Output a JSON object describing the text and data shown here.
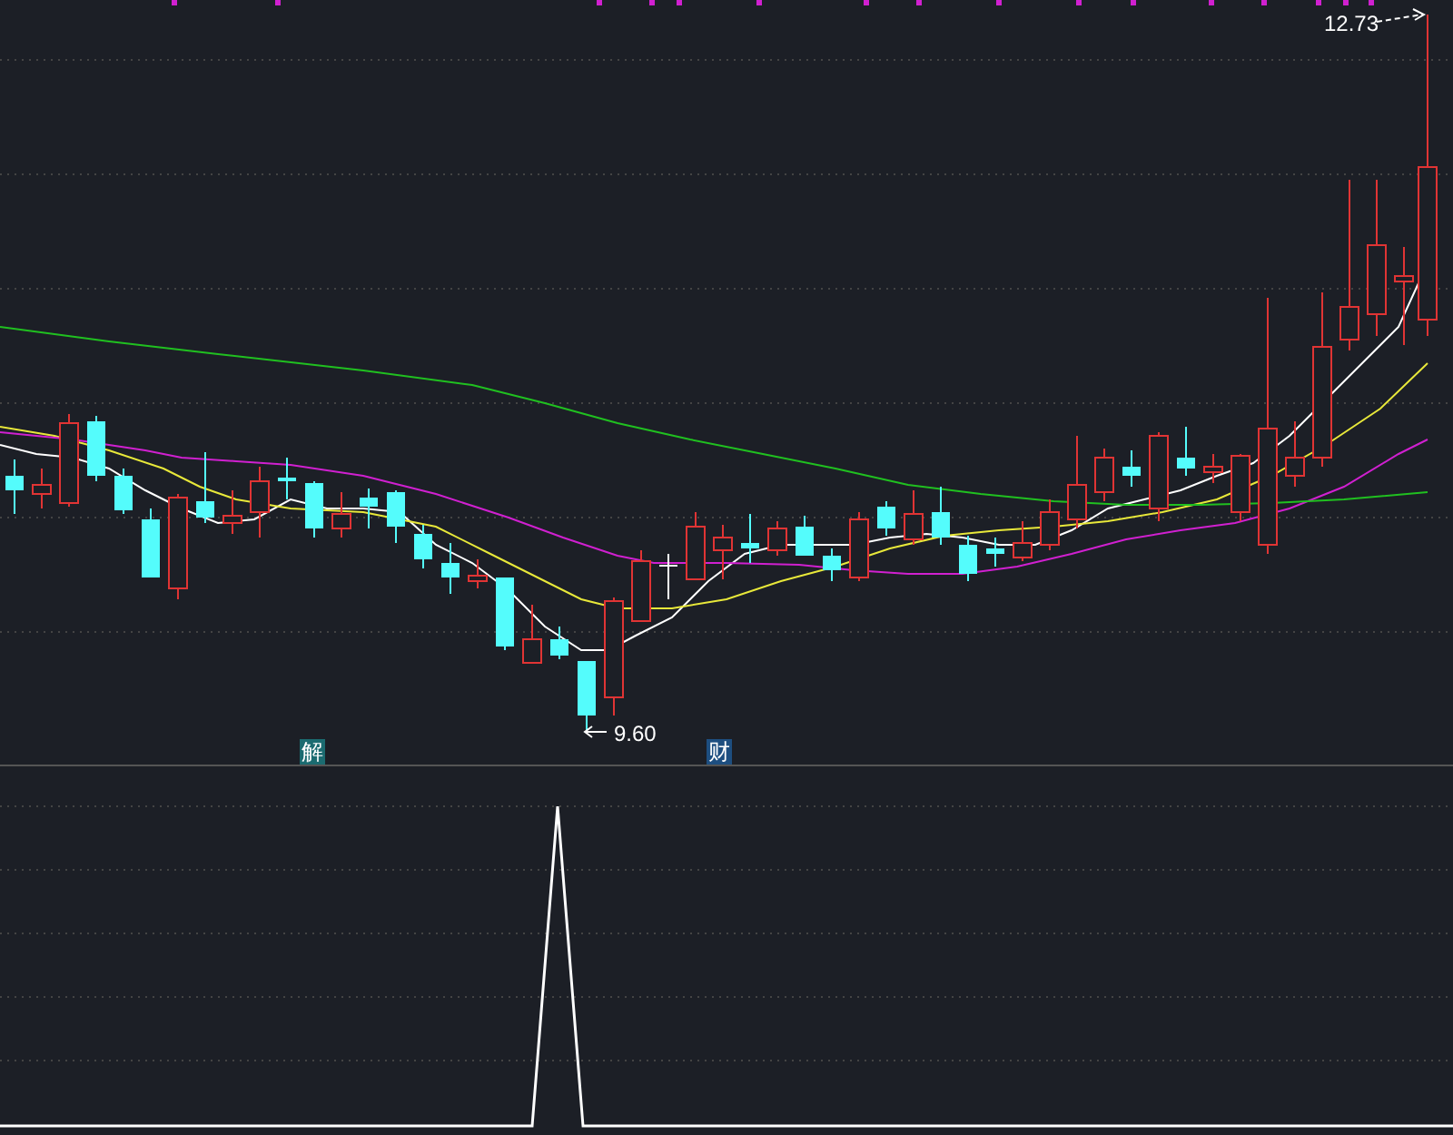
{
  "price_chart": {
    "high_label": "12.73",
    "low_label": "9.60",
    "signals": [
      {
        "label": "解",
        "color": "#1b6b70"
      },
      {
        "label": "财",
        "color": "#1d4e80"
      }
    ]
  }
}
